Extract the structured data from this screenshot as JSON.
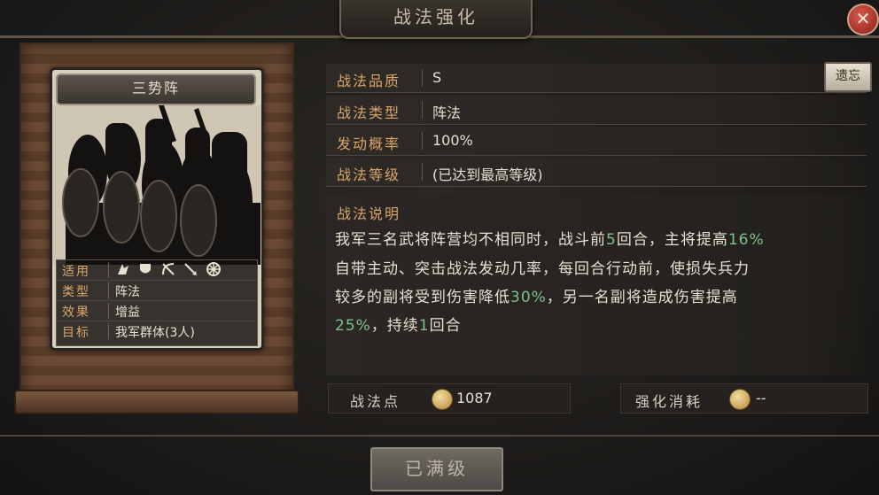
{
  "header": {
    "title": "战法强化",
    "close_icon": "close-icon"
  },
  "card": {
    "name": "三势阵",
    "rows": [
      {
        "key": "适用",
        "value": ""
      },
      {
        "key": "类型",
        "value": "阵法"
      },
      {
        "key": "效果",
        "value": "增益"
      },
      {
        "key": "目标",
        "value": "我军群体(3人)"
      }
    ],
    "troop_icons": [
      "cavalry-icon",
      "shield-icon",
      "bow-icon",
      "spear-icon",
      "wheel-icon"
    ]
  },
  "details": {
    "quality_label": "战法品质",
    "quality_value": "S",
    "type_label": "战法类型",
    "type_value": "阵法",
    "rate_label": "发动概率",
    "rate_value": "100%",
    "level_label": "战法等级",
    "level_value": "(已达到最高等级)",
    "reset_label": "遗忘"
  },
  "description": {
    "title": "战法说明",
    "line1": {
      "a": "我军三名武将阵营均不相同时，战斗前",
      "b": "5",
      "c": "回合，主将提高",
      "d": "16%"
    },
    "line2": "自带主动、突击战法发动几率，每回合行动前，使损失兵力",
    "line3": {
      "a": "较多的副将受到伤害降低",
      "b": "30%",
      "c": "，另一名副将造成伤害提高"
    },
    "line4": {
      "a": "25%",
      "b": "，持续",
      "c": "1",
      "d": "回合"
    }
  },
  "points": {
    "label": "战法点",
    "value": "1087"
  },
  "cost": {
    "label": "强化消耗",
    "value": "--"
  },
  "footer": {
    "max_label": "已满级"
  },
  "colors": {
    "accent_label": "#d9a56a",
    "highlight": "#7fc08b"
  }
}
